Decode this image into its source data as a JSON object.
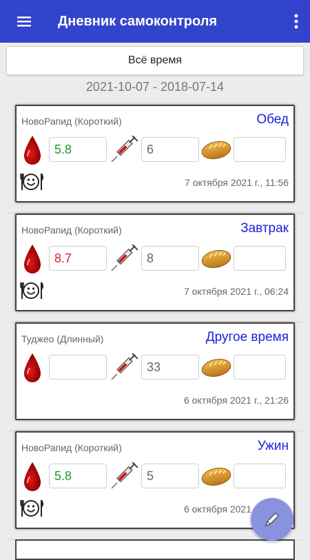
{
  "app": {
    "title": "Дневник самоконтроля"
  },
  "period_button": "Всё время",
  "date_range": "2021-10-07 - 2018-07-14",
  "entries": [
    {
      "insulin": "НовоРапид (Короткий)",
      "meal": "Обед",
      "sugar": "5.8",
      "sugar_status": "normal",
      "dose": "6",
      "bread_units": "",
      "datetime": "7 октября 2021 г., 11:56",
      "has_food_icon": true
    },
    {
      "insulin": "НовоРапид (Короткий)",
      "meal": "Завтрак",
      "sugar": "8.7",
      "sugar_status": "high",
      "dose": "8",
      "bread_units": "",
      "datetime": "7 октября 2021 г., 06:24",
      "has_food_icon": true
    },
    {
      "insulin": "Туджео (Длинный)",
      "meal": "Другое время",
      "sugar": "",
      "sugar_status": "none",
      "dose": "33",
      "bread_units": "",
      "datetime": "6 октября 2021 г., 21:26",
      "has_food_icon": false
    },
    {
      "insulin": "НовоРапид (Короткий)",
      "meal": "Ужин",
      "sugar": "5.8",
      "sugar_status": "normal",
      "dose": "5",
      "bread_units": "",
      "datetime": "6 октября 2021 г., 18:46",
      "has_food_icon": true
    }
  ],
  "colors": {
    "appbar": "#3344cc",
    "meal_label": "#1a22dd",
    "sugar_normal": "#1a9a2a",
    "sugar_high": "#e01c1c",
    "fab": "#8892e0"
  },
  "icons": {
    "menu": "hamburger-icon",
    "more": "more-vert-icon",
    "blood": "blood-drop-icon",
    "injection": "syringe-icon",
    "bread": "bread-icon",
    "food": "food-plate-icon",
    "edit": "pencil-icon"
  }
}
